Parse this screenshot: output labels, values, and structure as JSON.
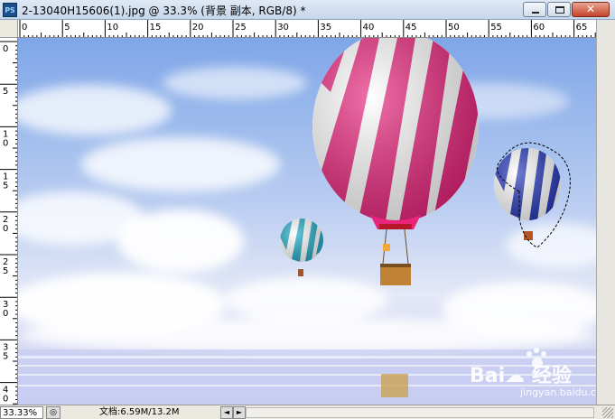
{
  "window": {
    "app_icon": "PS",
    "title": "2-13040H15606(1).jpg @ 33.3% (背景 副本, RGB/8) *",
    "icons": [
      "minimize-icon",
      "maximize-icon",
      "close-icon"
    ],
    "close_glyph": "✕"
  },
  "rulers": {
    "top_labels": [
      "0",
      "5",
      "10",
      "15",
      "20",
      "25",
      "30",
      "35",
      "40",
      "45",
      "50",
      "55",
      "60",
      "65"
    ],
    "left_labels": [
      "0",
      "5",
      "10",
      "15",
      "20",
      "25",
      "30",
      "35",
      "40"
    ]
  },
  "status": {
    "zoom": "33.33%",
    "doc_info": "文档:6.59M/13.2M",
    "nav_left": "◄",
    "nav_right": "►"
  },
  "watermark": {
    "brand": "Bai☁ 经验",
    "site": "jingyan.baidu.com"
  },
  "colors": {
    "sky_top": "#8fb3ec",
    "big_balloon": "#e8247b",
    "blue_balloon": "#2436b8",
    "teal_balloon": "#21a9c6"
  }
}
